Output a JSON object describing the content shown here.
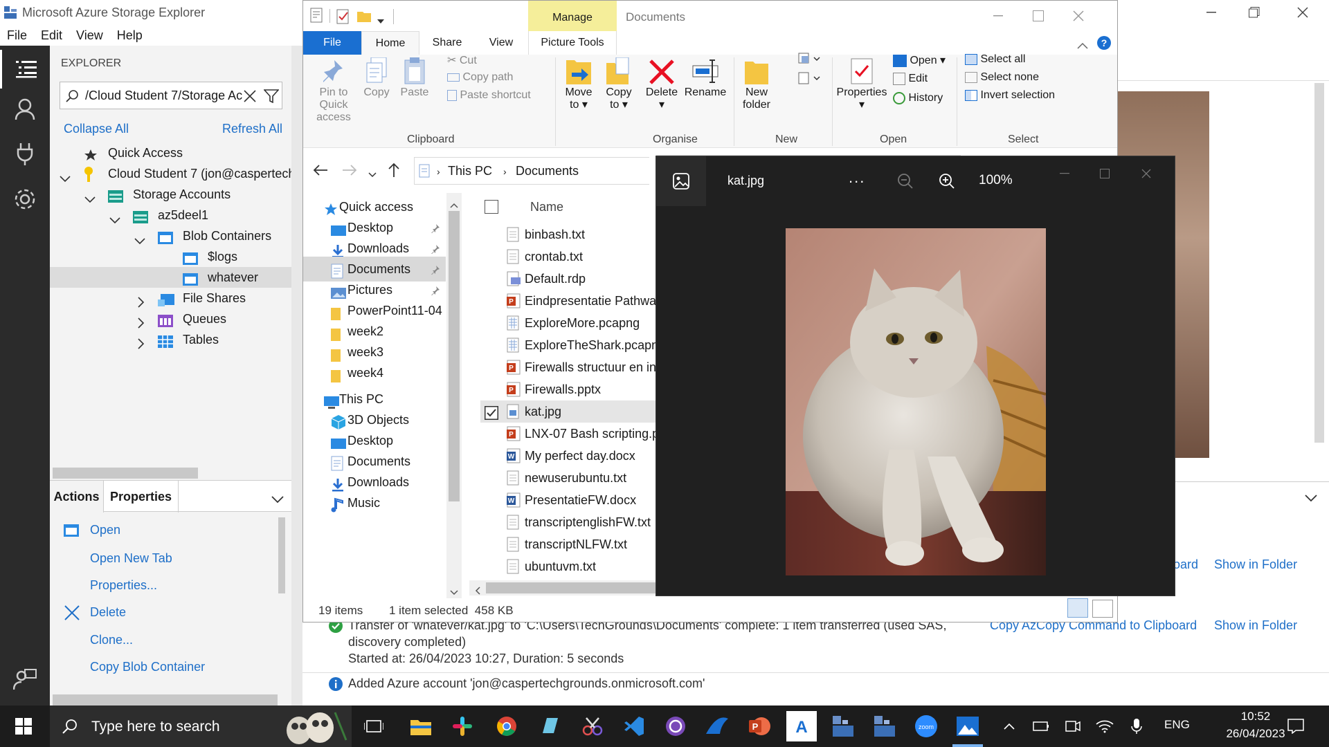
{
  "ase": {
    "title": "Microsoft Azure Storage Explorer",
    "menu": [
      "File",
      "Edit",
      "View",
      "Help"
    ],
    "explorer_label": "EXPLORER",
    "search_value": "/Cloud Student 7/Storage Ac",
    "collapse_all": "Collapse All",
    "refresh_all": "Refresh All",
    "tree": {
      "quick_access": "Quick Access",
      "account": "Cloud Student 7 (jon@caspertech",
      "storage_accounts": "Storage Accounts",
      "storage_account": "az5deel1",
      "blob_containers": "Blob Containers",
      "logs": "$logs",
      "whatever": "whatever",
      "file_shares": "File Shares",
      "queues": "Queues",
      "tables": "Tables"
    },
    "tabs": {
      "actions": "Actions",
      "properties": "Properties"
    },
    "actions": [
      "Open",
      "Open New Tab",
      "Properties...",
      "Delete",
      "Clone...",
      "Copy Blob Container"
    ],
    "activity": {
      "line1": "Transfer of 'whatever/kat.jpg' to 'C:\\Users\\TechGrounds\\Documents' complete: 1 item transferred (used SAS,",
      "line2": "discovery completed)",
      "line3": "Started at: 26/04/2023 10:27, Duration: 5 seconds",
      "copy_azcopy": "Copy AzCopy Command to Clipboard",
      "show_in_folder": "Show in Folder",
      "show_in_folder_2": "Show in Folder",
      "partial_board": "oard",
      "added_account": "Added Azure account 'jon@caspertechgrounds.onmicrosoft.com'"
    }
  },
  "explorer": {
    "context_tab": "Manage",
    "title": "Documents",
    "tabs": [
      "File",
      "Home",
      "Share",
      "View",
      "Picture Tools"
    ],
    "clipboard": {
      "pin": "Pin to Quick access",
      "copy": "Copy",
      "paste": "Paste",
      "cut": "Cut",
      "copy_path": "Copy path",
      "paste_shortcut": "Paste shortcut",
      "label": "Clipboard"
    },
    "organise": {
      "move_to": "Move to",
      "copy_to": "Copy to",
      "delete": "Delete",
      "rename": "Rename",
      "label": "Organise"
    },
    "new": {
      "new_folder": "New folder",
      "label": "New"
    },
    "open": {
      "properties": "Properties",
      "open": "Open",
      "edit": "Edit",
      "history": "History",
      "label": "Open"
    },
    "select": {
      "select_all": "Select all",
      "select_none": "Select none",
      "invert": "Invert selection",
      "label": "Select"
    },
    "breadcrumb": [
      "This PC",
      "Documents"
    ],
    "column_name": "Name",
    "nav": [
      {
        "label": "Quick access",
        "icon": "star-icon"
      },
      {
        "label": "Desktop",
        "icon": "desktop-icon",
        "pinned": true
      },
      {
        "label": "Downloads",
        "icon": "download-icon",
        "pinned": true
      },
      {
        "label": "Documents",
        "icon": "document-icon",
        "pinned": true,
        "selected": true
      },
      {
        "label": "Pictures",
        "icon": "pictures-icon",
        "pinned": true
      },
      {
        "label": "PowerPoint11-04",
        "icon": "folder-icon"
      },
      {
        "label": "week2",
        "icon": "folder-icon"
      },
      {
        "label": "week3",
        "icon": "folder-icon"
      },
      {
        "label": "week4",
        "icon": "folder-icon"
      },
      {
        "label": "This PC",
        "icon": "pc-icon"
      },
      {
        "label": "3D Objects",
        "icon": "cube-icon"
      },
      {
        "label": "Desktop",
        "icon": "desktop-icon"
      },
      {
        "label": "Documents",
        "icon": "document-icon"
      },
      {
        "label": "Downloads",
        "icon": "download-icon"
      },
      {
        "label": "Music",
        "icon": "music-icon"
      }
    ],
    "files": [
      {
        "name": "binbash.txt",
        "type": "txt"
      },
      {
        "name": "crontab.txt",
        "type": "txt"
      },
      {
        "name": "Default.rdp",
        "type": "rdp"
      },
      {
        "name": "Eindpresentatie Pathway",
        "type": "pptx"
      },
      {
        "name": "ExploreMore.pcapng",
        "type": "pcap"
      },
      {
        "name": "ExploreTheShark.pcapng",
        "type": "pcap"
      },
      {
        "name": "Firewalls structuur en inh",
        "type": "pptx"
      },
      {
        "name": "Firewalls.pptx",
        "type": "pptx"
      },
      {
        "name": "kat.jpg",
        "type": "jpg",
        "selected": true
      },
      {
        "name": "LNX-07 Bash scripting.p",
        "type": "pptx"
      },
      {
        "name": "My perfect day.docx",
        "type": "docx"
      },
      {
        "name": "newuserubuntu.txt",
        "type": "txt"
      },
      {
        "name": "PresentatieFW.docx",
        "type": "docx"
      },
      {
        "name": "transcriptenglishFW.txt",
        "type": "txt"
      },
      {
        "name": "transcriptNLFW.txt",
        "type": "txt"
      },
      {
        "name": "ubuntuvm.txt",
        "type": "txt"
      }
    ],
    "status": {
      "items": "19 items",
      "selected": "1 item selected  458 KB"
    }
  },
  "photos": {
    "filename": "kat.jpg",
    "zoom": "100%",
    "more": "..."
  },
  "taskbar": {
    "search_placeholder": "Type here to search",
    "lang": "ENG",
    "time": "10:52",
    "date": "26/04/2023"
  }
}
